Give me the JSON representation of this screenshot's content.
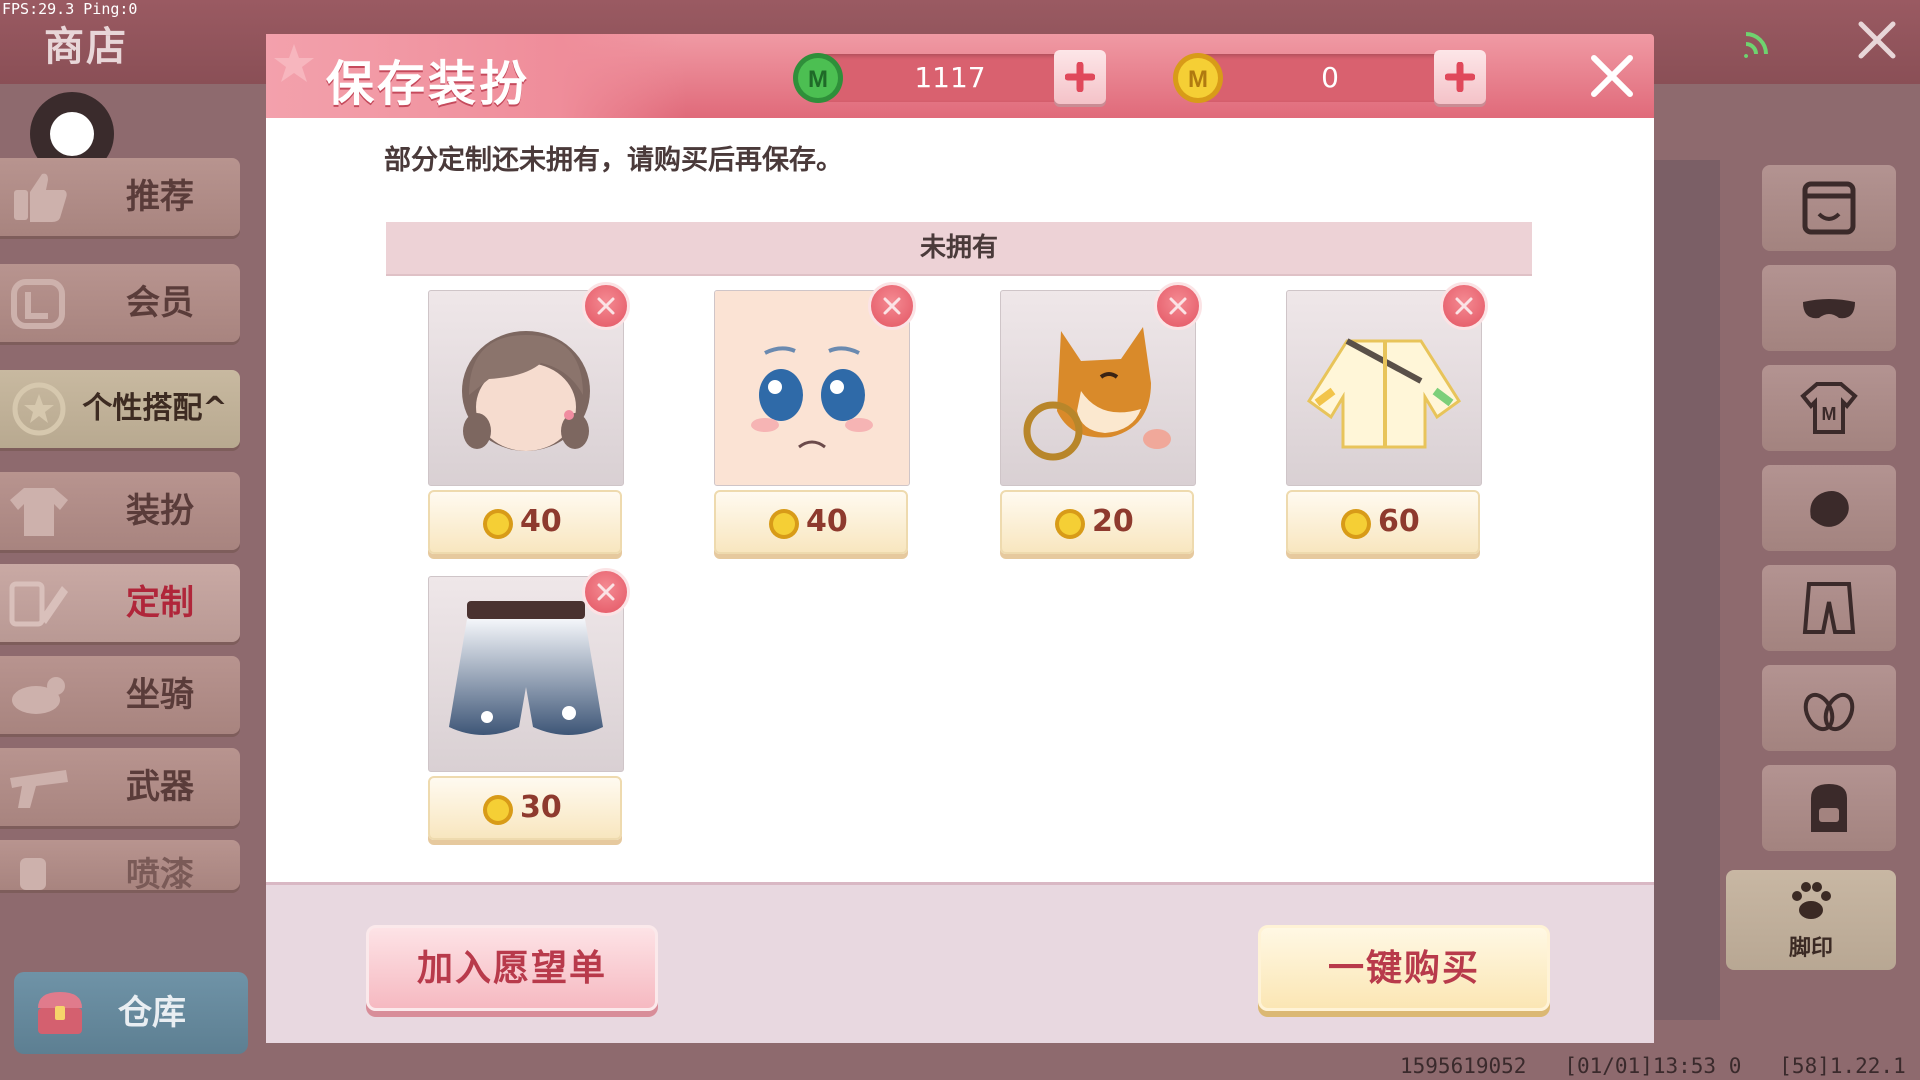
{
  "debug": {
    "fps_text": "FPS:29.3  Ping:0"
  },
  "shop": {
    "title": "商店"
  },
  "sidebar": {
    "items": [
      {
        "label": "推荐",
        "icon": "thumbs-up-icon"
      },
      {
        "label": "会员",
        "icon": "vip-icon"
      },
      {
        "label": "个性搭配^",
        "icon": "star-badge-icon"
      },
      {
        "label": "装扮",
        "icon": "shirt-icon"
      },
      {
        "label": "定制",
        "icon": "customize-icon"
      },
      {
        "label": "坐骑",
        "icon": "mount-icon"
      },
      {
        "label": "武器",
        "icon": "gun-icon"
      },
      {
        "label": "喷漆",
        "icon": "spray-icon"
      }
    ],
    "warehouse_label": "仓库"
  },
  "rightbar": {
    "footprint_label": "脚印"
  },
  "status_line": "1595619052   [01/01]13:53 0   [58]1.22.1",
  "modal": {
    "title": "保存装扮",
    "currency_gem": "1117",
    "currency_coin": "0",
    "notice": "部分定制还未拥有，请购买后再保存。",
    "section_title": "未拥有",
    "items": [
      {
        "kind": "hair",
        "price": "40"
      },
      {
        "kind": "face",
        "price": "40"
      },
      {
        "kind": "shiba-accessory",
        "price": "20"
      },
      {
        "kind": "jacket",
        "price": "60"
      },
      {
        "kind": "shorts",
        "price": "30"
      }
    ],
    "wishlist_label": "加入愿望单",
    "buy_all_label": "一键购买"
  },
  "colors": {
    "header_pink": "#e06a7a",
    "price_text": "#8e3a2e",
    "remove_red": "#e35563",
    "coin_gold": "#f2c12e",
    "gem_green": "#3aa84a"
  }
}
